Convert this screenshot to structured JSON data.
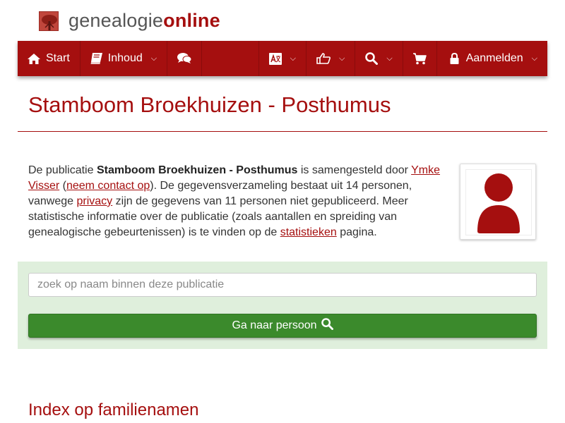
{
  "brand": {
    "part1": "genealogie",
    "part2": "online"
  },
  "nav": {
    "start_label": "Start",
    "content_label": "Inhoud",
    "login_label": "Aanmelden",
    "chevron": "⌵"
  },
  "icons": {
    "home": "home-icon",
    "book": "book-icon",
    "comments": "comments-icon",
    "language": "language-icon",
    "thumbs": "thumbs-up-icon",
    "search": "search-icon",
    "cart": "shopping-cart-icon",
    "lock": "lock-icon",
    "user": "user-icon"
  },
  "colors": {
    "brand": "#a50f0f",
    "success": "#3b8a2c",
    "panel": "#dfefdc"
  },
  "page": {
    "title": "Stamboom Broekhuizen - Posthumus"
  },
  "intro": {
    "t1": "De publicatie ",
    "pub_name": "Stamboom Broekhuizen - Posthumus",
    "t2": " is samengesteld door ",
    "author": "Ymke Visser",
    "t3": " (",
    "contact": "neem contact op",
    "t4": "). De gegevensverzameling bestaat uit 14 personen, vanwege ",
    "privacy": "privacy",
    "t5": " zijn de gegevens van 11 personen niet gepubliceerd. Meer statistische informatie over de publicatie (zoals aantallen en spreiding van genealogische gebeurtenissen) is te vinden op de ",
    "stats": "statistieken",
    "t6": " pagina."
  },
  "search": {
    "placeholder": "zoek op naam binnen deze publicatie",
    "button_label": "Ga naar persoon"
  },
  "index": {
    "title": "Index op familienamen"
  }
}
